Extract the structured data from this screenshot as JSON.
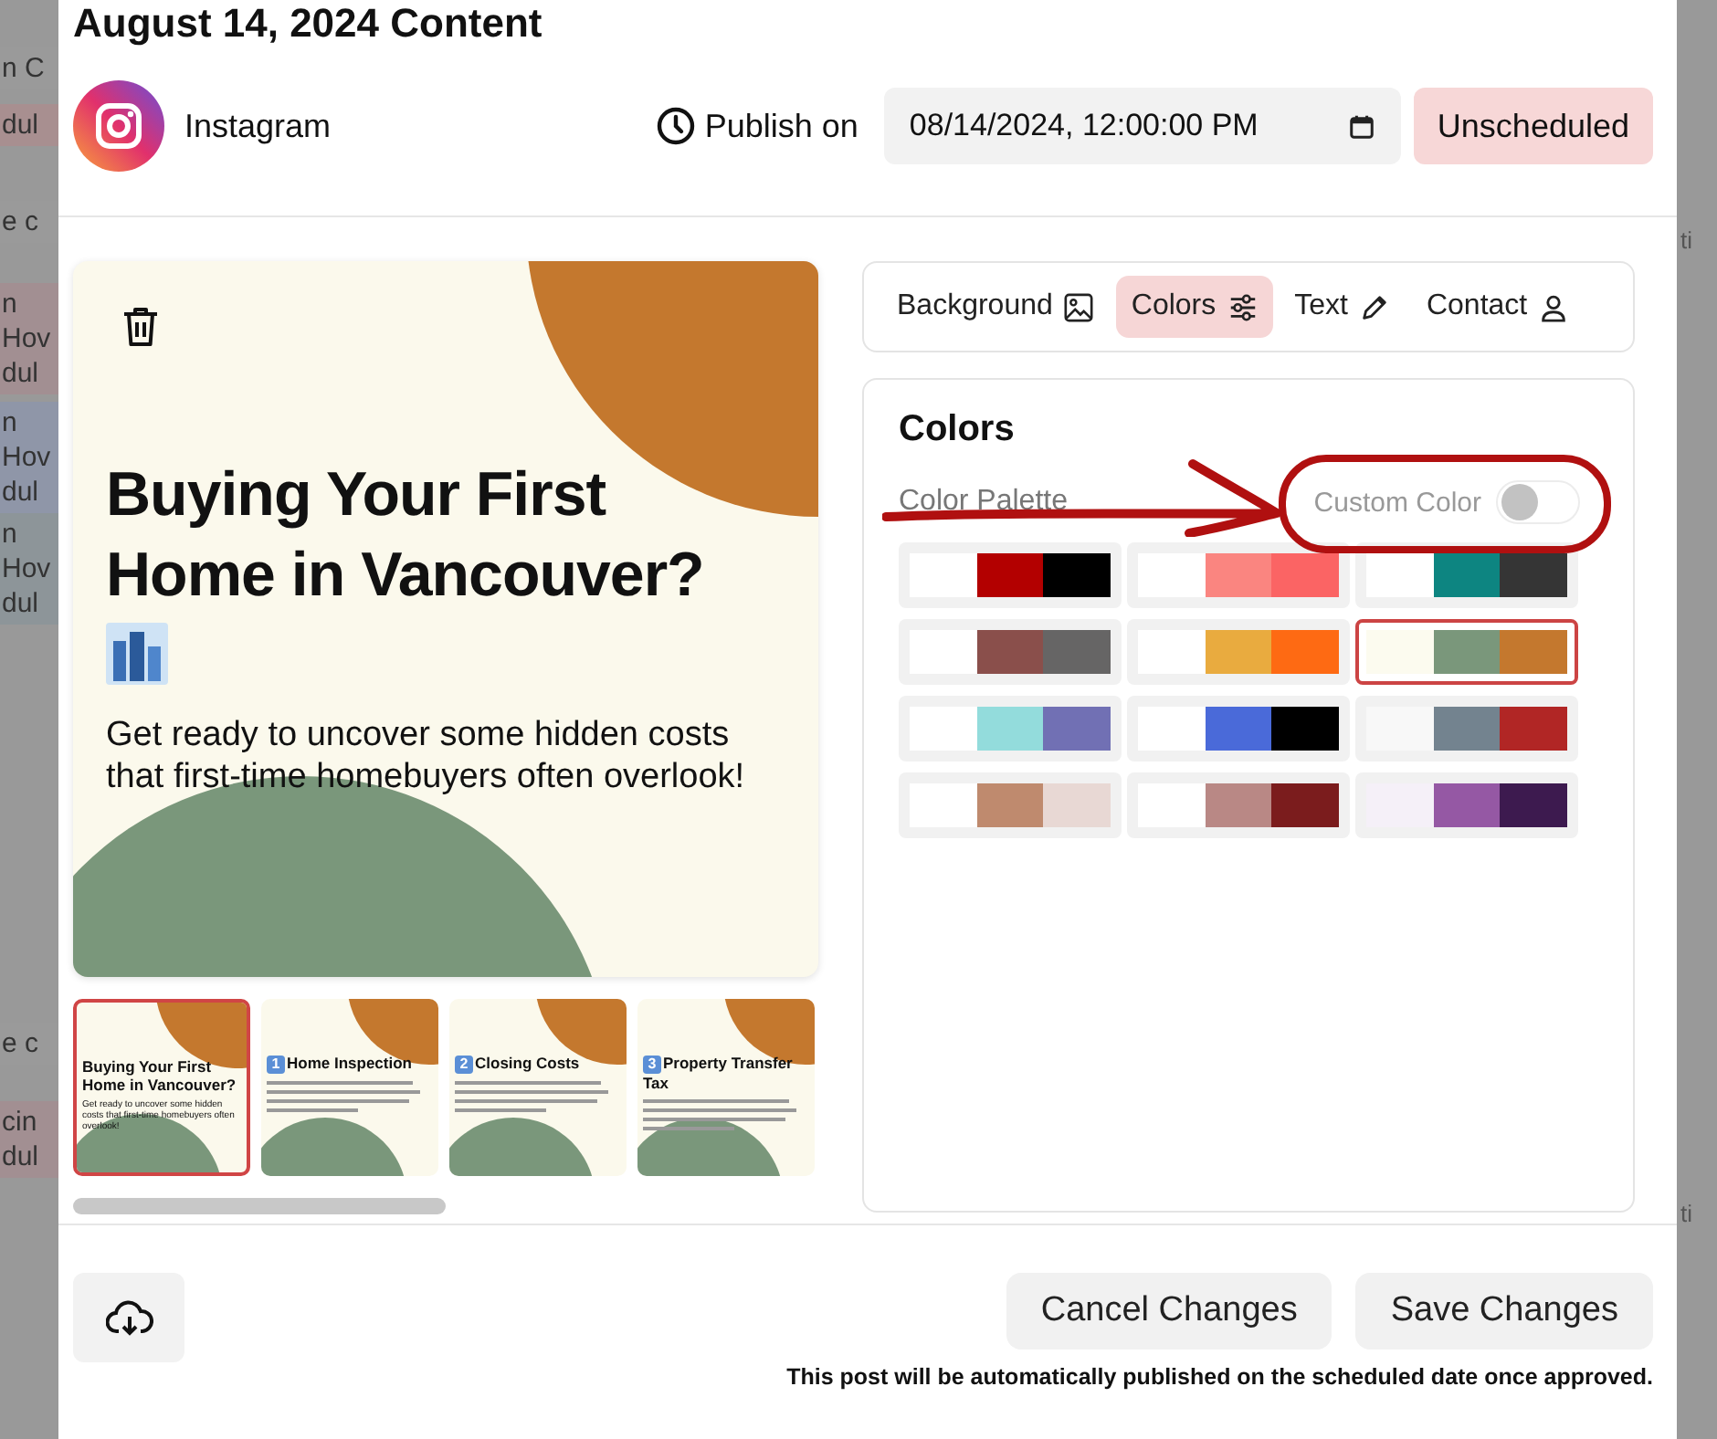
{
  "backdrop_left": [
    {
      "lines": [
        "n C"
      ],
      "color": "#9a9a9a"
    },
    {
      "lines": [
        "dul"
      ],
      "color": "#a88f90"
    },
    {
      "lines": [
        "e c"
      ],
      "color": "#9a9a9a"
    },
    {
      "lines": [
        "n",
        "Hov",
        "dul"
      ],
      "color": "#a28f92"
    },
    {
      "lines": [
        "n",
        "Hov",
        "dul"
      ],
      "color": "#8f96a8"
    },
    {
      "lines": [
        "n",
        "Hov",
        "dul"
      ],
      "color": "#8d9599"
    },
    {
      "lines": [
        "e c"
      ],
      "color": "#9a9a9a"
    },
    {
      "lines": [
        "cin",
        "dul"
      ],
      "color": "#a28f92"
    }
  ],
  "backdrop_right": [
    "ti",
    "ti"
  ],
  "modal": {
    "title": "August 14, 2024 Content",
    "platform": "Instagram",
    "publish_label": "Publish on",
    "publish_value": "08/14/2024, 12:00:00 PM",
    "status": "Unscheduled",
    "preview": {
      "title": "Buying Your First Home in Vancouver?",
      "body": "Get ready to uncover some hidden costs that first-time homebuyers often overlook!"
    },
    "slides": [
      {
        "title": "Buying Your First Home in Vancouver?",
        "body": "Get ready to uncover some hidden costs that first-time homebuyers often overlook!",
        "selected": true
      },
      {
        "number": "1",
        "title": "Home Inspection",
        "selected": false
      },
      {
        "number": "2",
        "title": "Closing Costs",
        "selected": false
      },
      {
        "number": "3",
        "title": "Property Transfer Tax",
        "selected": false
      }
    ],
    "tabs": [
      {
        "label": "Background",
        "kind": "image",
        "selected": false
      },
      {
        "label": "Colors",
        "kind": "sliders",
        "selected": true
      },
      {
        "label": "Text",
        "kind": "pencil",
        "selected": false
      },
      {
        "label": "Contact",
        "kind": "person",
        "selected": false
      }
    ],
    "colors_panel": {
      "heading": "Colors",
      "palette_label": "Color Palette",
      "custom_color": {
        "label": "Custom Color",
        "on": false
      },
      "palettes": [
        {
          "swatches": [
            {
              "color": "#ffffff"
            },
            {
              "color": "#b30000"
            },
            {
              "color": "#000000"
            }
          ],
          "selected": false
        },
        {
          "swatches": [
            {
              "color": "#ffffff"
            },
            {
              "color": "#fa8580"
            },
            {
              "color": "#fb6464"
            }
          ],
          "selected": false
        },
        {
          "swatches": [
            {
              "color": "#ffffff"
            },
            {
              "color": "#0d8581"
            },
            {
              "color": "#353535"
            }
          ],
          "selected": false
        },
        {
          "swatches": [
            {
              "color": "#ffffff"
            },
            {
              "color": "#8a4f4b"
            },
            {
              "color": "#666565"
            }
          ],
          "selected": false
        },
        {
          "swatches": [
            {
              "color": "#ffffff"
            },
            {
              "color": "#e9ab3f"
            },
            {
              "color": "#fe6a13"
            }
          ],
          "selected": false
        },
        {
          "swatches": [
            {
              "color": "#fcfbef"
            },
            {
              "color": "#7a977b"
            },
            {
              "color": "#c4782e"
            }
          ],
          "selected": true
        },
        {
          "swatches": [
            {
              "color": "#ffffff"
            },
            {
              "color": "#93dcdc"
            },
            {
              "color": "#7170b4"
            }
          ],
          "selected": false
        },
        {
          "swatches": [
            {
              "color": "#ffffff"
            },
            {
              "color": "#4a6ad9"
            },
            {
              "color": "#000000"
            }
          ],
          "selected": false
        },
        {
          "swatches": [
            {
              "color": "#f8f8f8"
            },
            {
              "color": "#73838f"
            },
            {
              "color": "#b12625"
            }
          ],
          "selected": false
        },
        {
          "swatches": [
            {
              "color": "#ffffff"
            },
            {
              "color": "#bf8a6e"
            },
            {
              "color": "#e8d8d4"
            }
          ],
          "selected": false
        },
        {
          "swatches": [
            {
              "color": "#ffffff"
            },
            {
              "color": "#b98885"
            },
            {
              "color": "#7b1c1d"
            }
          ],
          "selected": false
        },
        {
          "swatches": [
            {
              "color": "#f5f0f8"
            },
            {
              "color": "#9558a4"
            },
            {
              "color": "#3d1a4f"
            }
          ],
          "selected": false
        }
      ]
    },
    "buttons": [
      "Cancel Changes",
      "Save Changes"
    ],
    "note": "This post will be automatically published on the scheduled date once approved."
  }
}
